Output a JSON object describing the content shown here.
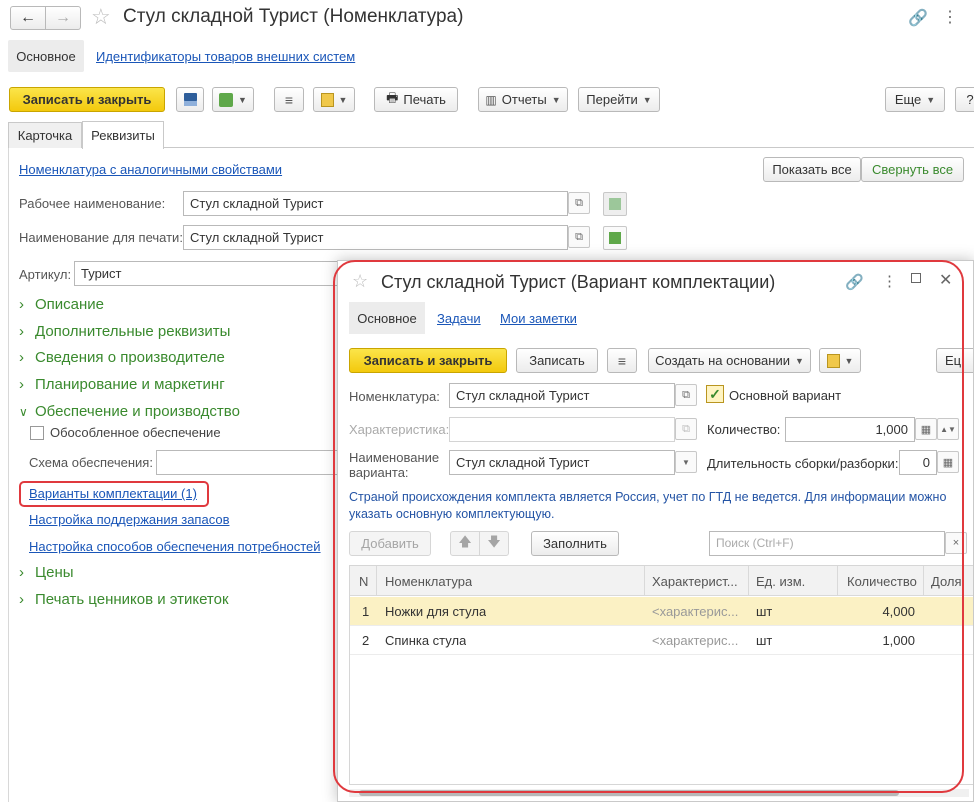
{
  "main_window": {
    "title": "Стул складной Турист (Номенклатура)",
    "nav_tabs": [
      "Основное",
      "Идентификаторы товаров внешних систем"
    ],
    "toolbar": {
      "save_close": "Записать и закрыть",
      "print": "Печать",
      "reports": "Отчеты",
      "go": "Перейти",
      "more": "Еще",
      "help": "?"
    },
    "tabs": [
      "Карточка",
      "Реквизиты"
    ],
    "similar_link": "Номенклатура с аналогичными свойствами",
    "show_all": "Показать все",
    "collapse_all": "Свернуть все",
    "working_name_label": "Рабочее наименование:",
    "working_name_value": "Стул складной Турист",
    "print_name_label": "Наименование для печати:",
    "print_name_value": "Стул складной Турист",
    "article_label": "Артикул:",
    "article_value": "Турист",
    "groups": [
      "Описание",
      "Дополнительные реквизиты",
      "Сведения о производителе",
      "Планирование и маркетинг",
      "Обеспечение и производство"
    ],
    "separate_supply": "Обособленное обеспечение",
    "supply_scheme_label": "Схема обеспечения:",
    "links": [
      "Варианты комплектации (1)",
      "Настройка поддержания запасов",
      "Настройка способов обеспечения потребностей"
    ],
    "groups_bottom": [
      "Цены",
      "Печать ценников и этикеток"
    ]
  },
  "dialog": {
    "title": "Стул складной Турист (Вариант комплектации)",
    "tabs": [
      "Основное",
      "Задачи",
      "Мои заметки"
    ],
    "toolbar": {
      "save_close": "Записать и закрыть",
      "save": "Записать",
      "create_based": "Создать на основании",
      "more": "Ец"
    },
    "nomenclature_label": "Номенклатура:",
    "nomenclature_value": "Стул складной Турист",
    "main_variant_label": "Основной вариант",
    "characteristic_label": "Характеристика:",
    "quantity_label": "Количество:",
    "quantity_value": "1,000",
    "variant_name_label": "Наименование варианта:",
    "variant_name_value": "Стул складной Турист",
    "duration_label": "Длительность сборки/разборки:",
    "duration_value": "0",
    "info_text": "Страной происхождения комплекта является Россия, учет по ГТД не ведется. Для информации можно указать основную комплектующую.",
    "add_button": "Добавить",
    "fill_button": "Заполнить",
    "search_placeholder": "Поиск (Ctrl+F)",
    "table": {
      "columns": [
        "N",
        "Номенклатура",
        "Характерист...",
        "Ед. изм.",
        "Количество",
        "Доля"
      ],
      "rows": [
        {
          "n": "1",
          "name": "Ножки для стула",
          "char": "<характерис...",
          "unit": "шт",
          "qty": "4,000"
        },
        {
          "n": "2",
          "name": "Спинка стула",
          "char": "<характерис...",
          "unit": "шт",
          "qty": "1,000"
        }
      ]
    }
  },
  "colors": {
    "accent_green": "#3a8a2e",
    "link_blue": "#1a56b8",
    "primary_yellow": "#f5d11d",
    "highlight_red": "#e0393e",
    "selected_row": "#fbf1c4"
  }
}
